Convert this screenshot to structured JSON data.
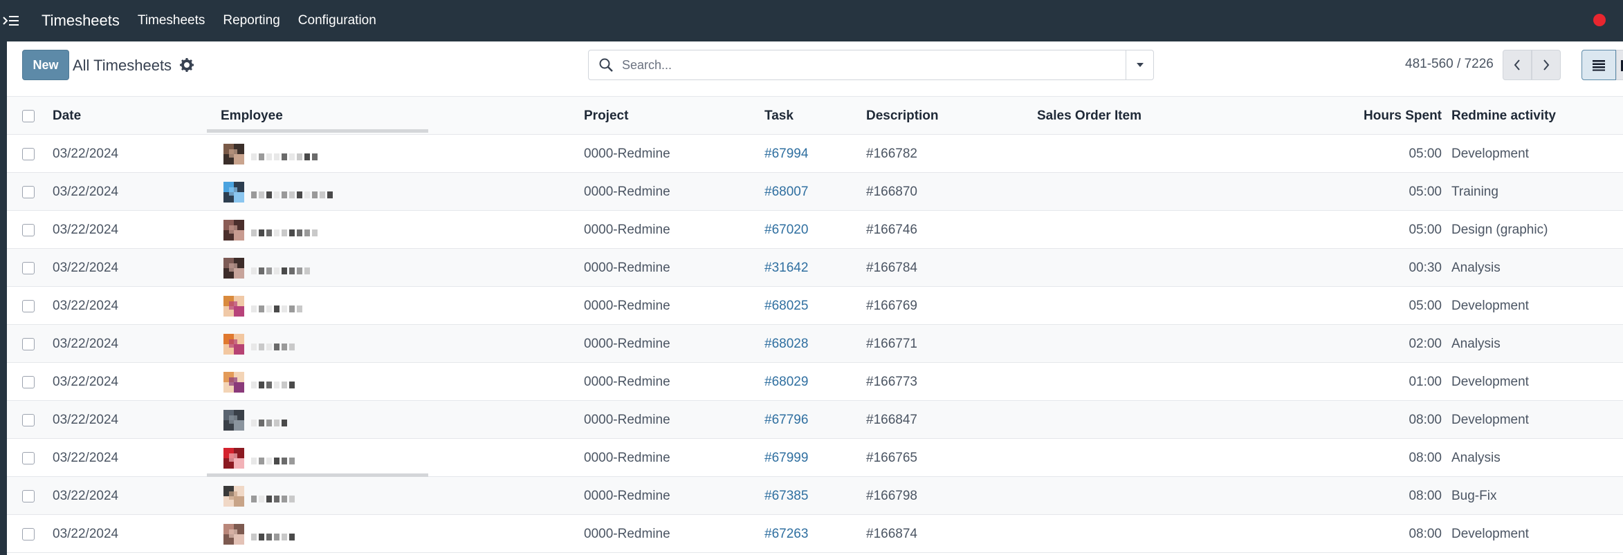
{
  "navbar": {
    "app_title": "Timesheets",
    "menu": [
      "Timesheets",
      "Reporting",
      "Configuration"
    ]
  },
  "control_panel": {
    "new_label": "New",
    "view_title": "All Timesheets",
    "search_placeholder": "Search...",
    "pager": "481-560 / 7226"
  },
  "table": {
    "columns": [
      "Date",
      "Employee",
      "Project",
      "Task",
      "Description",
      "Sales Order Item",
      "Hours Spent",
      "Redmine activity"
    ],
    "rows": [
      {
        "date": "03/22/2024",
        "project": "0000-Redmine",
        "task": "#67994",
        "description": "#166782",
        "hours": "05:00",
        "activity": "Development"
      },
      {
        "date": "03/22/2024",
        "project": "0000-Redmine",
        "task": "#68007",
        "description": "#166870",
        "hours": "05:00",
        "activity": "Training"
      },
      {
        "date": "03/22/2024",
        "project": "0000-Redmine",
        "task": "#67020",
        "description": "#166746",
        "hours": "05:00",
        "activity": "Design (graphic)"
      },
      {
        "date": "03/22/2024",
        "project": "0000-Redmine",
        "task": "#31642",
        "description": "#166784",
        "hours": "00:30",
        "activity": "Analysis"
      },
      {
        "date": "03/22/2024",
        "project": "0000-Redmine",
        "task": "#68025",
        "description": "#166769",
        "hours": "05:00",
        "activity": "Development"
      },
      {
        "date": "03/22/2024",
        "project": "0000-Redmine",
        "task": "#68028",
        "description": "#166771",
        "hours": "02:00",
        "activity": "Analysis"
      },
      {
        "date": "03/22/2024",
        "project": "0000-Redmine",
        "task": "#68029",
        "description": "#166773",
        "hours": "01:00",
        "activity": "Development"
      },
      {
        "date": "03/22/2024",
        "project": "0000-Redmine",
        "task": "#67796",
        "description": "#166847",
        "hours": "08:00",
        "activity": "Development"
      },
      {
        "date": "03/22/2024",
        "project": "0000-Redmine",
        "task": "#67999",
        "description": "#166765",
        "hours": "08:00",
        "activity": "Analysis"
      },
      {
        "date": "03/22/2024",
        "project": "0000-Redmine",
        "task": "#67385",
        "description": "#166798",
        "hours": "08:00",
        "activity": "Bug-Fix"
      },
      {
        "date": "03/22/2024",
        "project": "0000-Redmine",
        "task": "#67263",
        "description": "#166874",
        "hours": "08:00",
        "activity": "Development"
      }
    ]
  },
  "colors": {
    "navbar_bg": "#263440",
    "primary": "#5d8aa8",
    "link": "#2f6fa0",
    "notification": "#e8262f"
  }
}
